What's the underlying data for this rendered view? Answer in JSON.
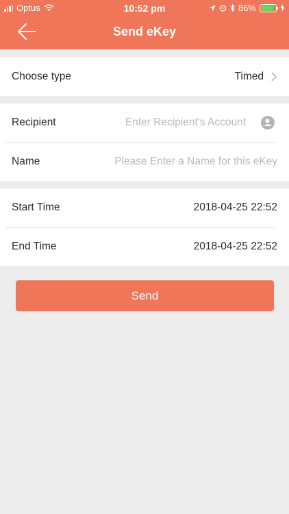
{
  "status_bar": {
    "carrier": "Optus",
    "time": "10:52 pm",
    "battery": "86%",
    "battery_level": 0.86
  },
  "nav": {
    "title": "Send eKey",
    "back_icon": "arrow-left-icon"
  },
  "type_row": {
    "label": "Choose type",
    "value": "Timed"
  },
  "recipient": {
    "label": "Recipient",
    "placeholder": "Enter Recipient's Account",
    "icon": "contact-icon"
  },
  "name": {
    "label": "Name",
    "placeholder": "Please Enter a Name for this eKey"
  },
  "start_time": {
    "label": "Start Time",
    "value": "2018-04-25 22:52"
  },
  "end_time": {
    "label": "End Time",
    "value": "2018-04-25 22:52"
  },
  "send_button": {
    "label": "Send"
  },
  "colors": {
    "accent": "#ef7659",
    "background": "#ececec",
    "placeholder": "#b9b9b9",
    "battery": "#6fd35a"
  }
}
